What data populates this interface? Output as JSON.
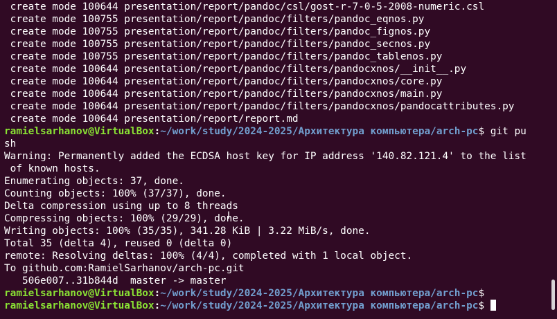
{
  "terminal": {
    "output_lines": [
      " create mode 100644 presentation/report/pandoc/csl/gost-r-7-0-5-2008-numeric.csl",
      " create mode 100755 presentation/report/pandoc/filters/pandoc_eqnos.py",
      " create mode 100755 presentation/report/pandoc/filters/pandoc_fignos.py",
      " create mode 100755 presentation/report/pandoc/filters/pandoc_secnos.py",
      " create mode 100755 presentation/report/pandoc/filters/pandoc_tablenos.py",
      " create mode 100644 presentation/report/pandoc/filters/pandocxnos/__init__.py",
      " create mode 100644 presentation/report/pandoc/filters/pandocxnos/core.py",
      " create mode 100644 presentation/report/pandoc/filters/pandocxnos/main.py",
      " create mode 100644 presentation/report/pandoc/filters/pandocxnos/pandocattributes.py",
      " create mode 100644 presentation/report/report.md"
    ],
    "prompt": {
      "user_host": "ramielsarhanov@VirtualBox",
      "colon": ":",
      "path": "~/work/study/2024-2025/Архитектура компьютера/arch-pc",
      "symbol": "$"
    },
    "command_part1": " git pu",
    "command_part2": "sh",
    "push_output": [
      "Warning: Permanently added the ECDSA host key for IP address '140.82.121.4' to the list",
      " of known hosts.",
      "Enumerating objects: 37, done.",
      "Counting objects: 100% (37/37), done.",
      "Delta compression using up to 8 threads",
      "Compressing objects: 100% (29/29), done.",
      "Writing objects: 100% (35/35), 341.28 KiB | 3.22 MiB/s, done.",
      "Total 35 (delta 4), reused 0 (delta 0)",
      "remote: Resolving deltas: 100% (4/4), completed with 1 local object.",
      "To github.com:RamielSarhanov/arch-pc.git",
      "   506e007..31b844d  master -> master"
    ],
    "colors": {
      "background": "#300a24",
      "user_host": "#8ae234",
      "path": "#729fcf",
      "text": "#ffffff"
    }
  }
}
